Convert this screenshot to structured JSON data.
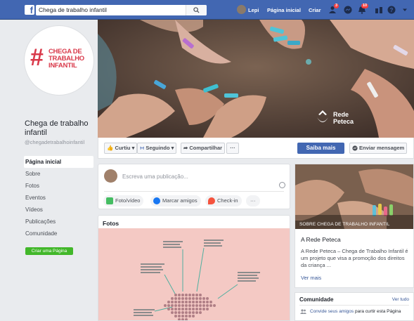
{
  "topbar": {
    "search_value": "Chega de trabalho infantil",
    "user_name": "Lepi",
    "nav_home": "Página inicial",
    "nav_create": "Criar",
    "badges": {
      "friends": "3",
      "notifications": "10"
    }
  },
  "page": {
    "logo_lines": [
      "CHEGA DE",
      "TRABALHO",
      "INFANTIL"
    ],
    "name": "Chega de trabalho infantil",
    "handle": "@chegadetrabalhoinfantil"
  },
  "menu": {
    "items": [
      "Página inicial",
      "Sobre",
      "Fotos",
      "Eventos",
      "Vídeos",
      "Publicações",
      "Comunidade"
    ],
    "create_page": "Criar uma Página"
  },
  "cover": {
    "logo_line1": "Rede",
    "logo_line2": "Peteca"
  },
  "actions": {
    "like": "Curtiu",
    "follow": "Seguindo",
    "share": "Compartilhar",
    "more": "···",
    "learn_more": "Saiba mais",
    "send_message": "Enviar mensagem"
  },
  "composer": {
    "placeholder": "Escreva uma publicação...",
    "photo_video": "Foto/vídeo",
    "tag_friends": "Marcar amigos",
    "checkin": "Check-in",
    "more": "···"
  },
  "photos": {
    "title": "Fotos"
  },
  "about": {
    "image_caption": "SOBRE CHEGA DE TRABALHO INFANTIL",
    "title": "A Rede Peteca",
    "description": "A Rede Peteca – Chega de Trabalho Infantil é um projeto que visa a promoção dos direitos da criança ...",
    "see_more": "Ver mais"
  },
  "community": {
    "title": "Comunidade",
    "see_all": "Ver tudo",
    "invite_link": "Convide seus amigos",
    "invite_rest": " para curtir esta Página"
  },
  "colors": {
    "facebook_blue": "#4267b2",
    "background": "#e9ebee",
    "brand_red": "#d9394a",
    "create_green": "#42b72a",
    "link": "#385898"
  }
}
